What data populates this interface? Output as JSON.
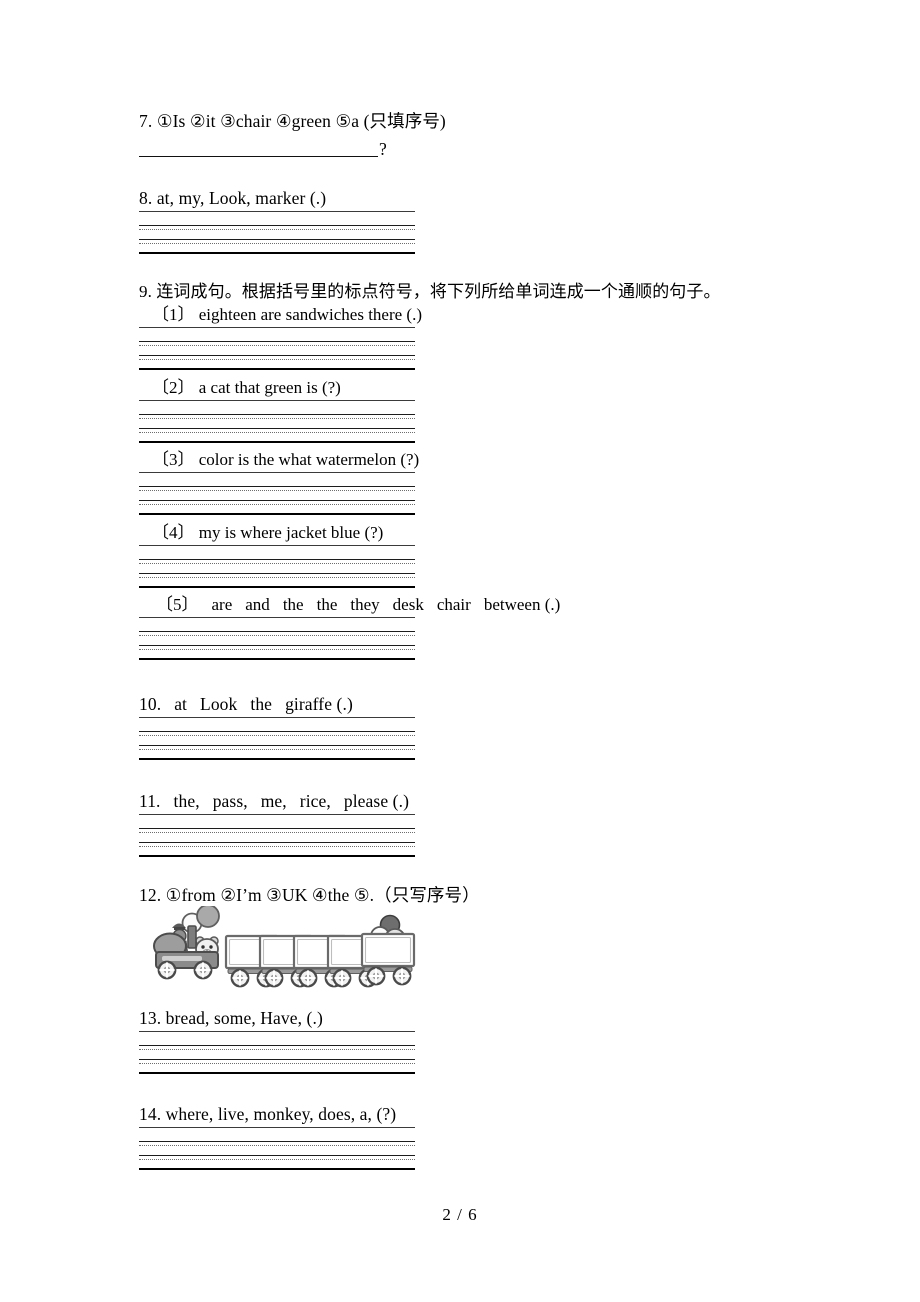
{
  "document": {
    "page_label": "2 / 6",
    "language": "zh-CN + en"
  },
  "items": {
    "q7": {
      "number": "7.",
      "text": "①Is ②it ③chair ④green ⑤a (只填序号)",
      "answer_mark": "?"
    },
    "q8": {
      "number": "8.",
      "text": "at, my, Look, marker (.)"
    },
    "q9": {
      "number": "9.",
      "text": "连词成句。根据括号里的标点符号，将下列所给单词连成一个通顺的句子。",
      "subitems": [
        {
          "label": "〔1〕",
          "text": "eighteen are sandwiches there (.)"
        },
        {
          "label": "〔2〕",
          "text": "a cat that green is (?)"
        },
        {
          "label": "〔3〕",
          "text": "color is the what watermelon (?)"
        },
        {
          "label": "〔4〕",
          "text": "my is where jacket blue (?)"
        },
        {
          "label": "〔5〕",
          "words": [
            "are",
            "and",
            "the",
            "the",
            "they",
            "desk",
            "chair",
            "between (.)"
          ]
        }
      ]
    },
    "q10": {
      "number": "10.",
      "words": [
        "at",
        "Look",
        "the",
        "giraffe (.)"
      ]
    },
    "q11": {
      "number": "11.",
      "words": [
        "the,",
        "pass,",
        "me,",
        "rice,",
        "please (.)"
      ]
    },
    "q12": {
      "number": "12.",
      "text": "①from ②I’m ③UK ④the ⑤.（只写序号）",
      "illustration": "train-with-five-empty-cars"
    },
    "q13": {
      "number": "13.",
      "text": "bread, some, Have, (.)"
    },
    "q14": {
      "number": "14.",
      "text": "where, live, monkey, does, a, (?)"
    }
  },
  "colors": {
    "text": "#000000",
    "rule_thick": "#000000",
    "rule_thin": "#3a3a3a",
    "rule_dotted": "#6d6d6d",
    "illustration": "#808080"
  }
}
